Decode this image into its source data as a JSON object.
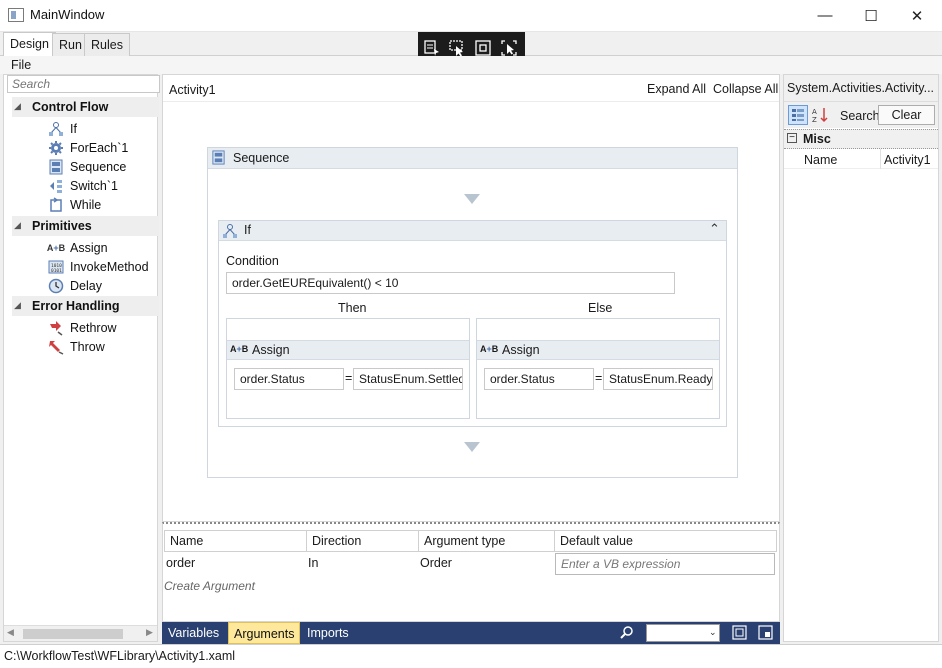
{
  "window": {
    "title": "MainWindow",
    "minimize": "—",
    "maximize": "☐",
    "close": "✕"
  },
  "tabs": [
    {
      "label": "Design"
    },
    {
      "label": "Run"
    },
    {
      "label": "Rules"
    }
  ],
  "menu": {
    "file": "File"
  },
  "toolbox": {
    "search_placeholder": "Search",
    "categories": [
      {
        "label": "Control Flow",
        "items": [
          "If",
          "ForEach`1",
          "Sequence",
          "Switch`1",
          "While"
        ]
      },
      {
        "label": "Primitives",
        "items": [
          "Assign",
          "InvokeMethod",
          "Delay"
        ]
      },
      {
        "label": "Error Handling",
        "items": [
          "Rethrow",
          "Throw"
        ]
      }
    ]
  },
  "designer": {
    "breadcrumb": "Activity1",
    "expand_all": "Expand All",
    "collapse_all": "Collapse All",
    "sequence_label": "Sequence",
    "if_label": "If",
    "condition_label": "Condition",
    "condition_value": "order.GetEUREquivalent() < 10",
    "then_label": "Then",
    "else_label": "Else",
    "then_assign": {
      "label": "Assign",
      "to": "order.Status",
      "eq": "=",
      "value": "StatusEnum.Settled"
    },
    "else_assign": {
      "label": "Assign",
      "to": "order.Status",
      "eq": "=",
      "value": "StatusEnum.Ready"
    }
  },
  "arguments": {
    "columns": [
      "Name",
      "Direction",
      "Argument type",
      "Default value"
    ],
    "rows": [
      {
        "name": "order",
        "direction": "In",
        "type": "Order",
        "default_placeholder": "Enter a VB expression"
      }
    ],
    "create_label": "Create Argument"
  },
  "bottom_tabs": [
    {
      "label": "Variables"
    },
    {
      "label": "Arguments",
      "active": true
    },
    {
      "label": "Imports"
    }
  ],
  "properties": {
    "title": "System.Activities.Activity...",
    "search_label": "Search:",
    "clear_label": "Clear",
    "category": "Misc",
    "prop_name": "Name",
    "prop_value": "Activity1"
  },
  "status": {
    "path": "C:\\WorkflowTest\\WFLibrary\\Activity1.xaml"
  },
  "colors": {
    "arg_bar": "#294070",
    "active_tab": "#fde89b",
    "activity_header": "#e8edf2"
  }
}
